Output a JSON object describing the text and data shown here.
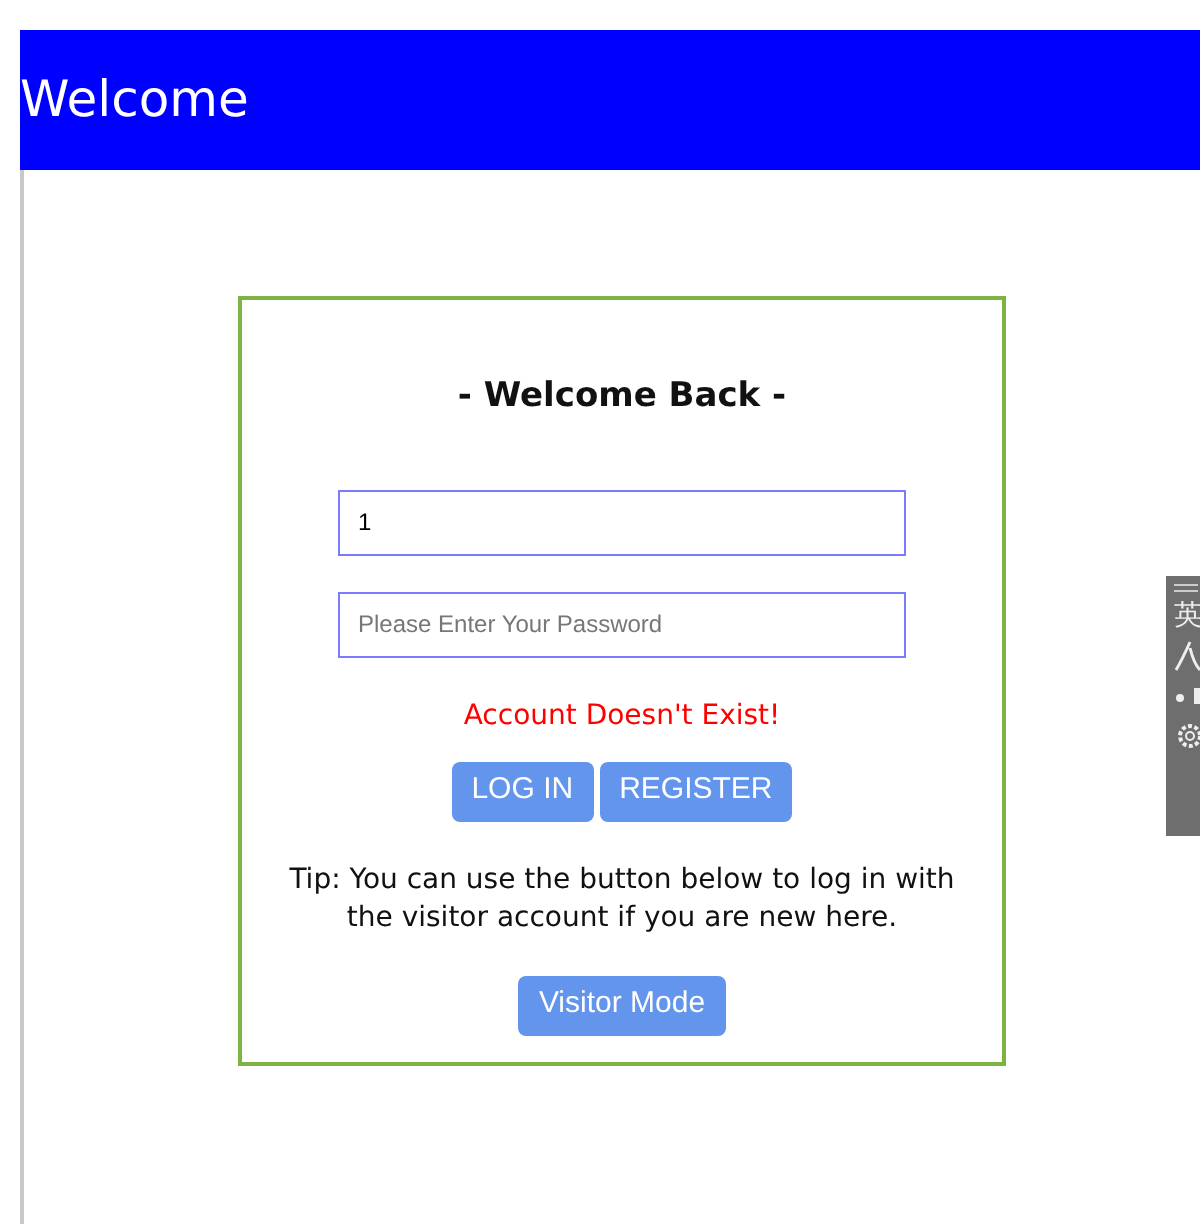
{
  "header": {
    "title": "Welcome"
  },
  "login": {
    "heading": "- Welcome Back -",
    "username": {
      "value": "1"
    },
    "password": {
      "placeholder": "Please Enter Your Password"
    },
    "error": "Account Doesn't Exist!",
    "buttons": [
      "LOG IN",
      "REGISTER"
    ],
    "tip": "Tip: You can use the button below to log in with the visitor account if you are new here.",
    "visitor_button": "Visitor Mode"
  },
  "ime_toolbar": {
    "mode": "英"
  }
}
